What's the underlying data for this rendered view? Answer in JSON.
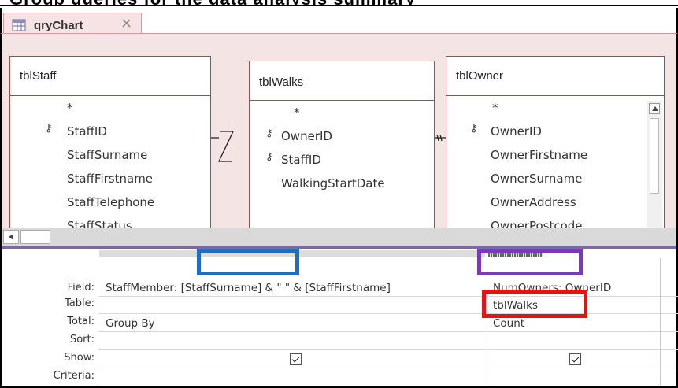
{
  "banner_text": "Group queries for the data analysis summary",
  "tab": {
    "title": "qryChart",
    "close": "×",
    "icon": "query-icon"
  },
  "tables": [
    {
      "name": "tblStaff",
      "fields": [
        "*",
        "StaffID",
        "StaffSurname",
        "StaffFirstname",
        "StaffTelephone",
        "StaffStatus"
      ],
      "keys": [
        1
      ]
    },
    {
      "name": "tblWalks",
      "fields": [
        "*",
        "OwnerID",
        "StaffID",
        "WalkingStartDate"
      ],
      "keys": [
        1,
        2
      ]
    },
    {
      "name": "tblOwner",
      "fields": [
        "*",
        "OwnerID",
        "OwnerFirstname",
        "OwnerSurname",
        "OwnerAddress",
        "OwnerPostcode"
      ],
      "keys": [
        1
      ]
    }
  ],
  "design_grid": {
    "row_labels": [
      "Field:",
      "Table:",
      "Total:",
      "Sort:",
      "Show:",
      "Criteria:"
    ],
    "columns": [
      {
        "field": "StaffMember: [StaffSurname] & \" \" & [StaffFirstname]",
        "table": "",
        "total": "Group By",
        "sort": "",
        "show": true,
        "criteria": ""
      },
      {
        "field": "NumOwners: OwnerID",
        "table": "tblWalks",
        "total": "Count",
        "sort": "",
        "show": true,
        "criteria": ""
      }
    ]
  },
  "highlight_colors": {
    "blue": "#1f6fbf",
    "purple": "#7b3ab8",
    "red": "#e01515"
  }
}
